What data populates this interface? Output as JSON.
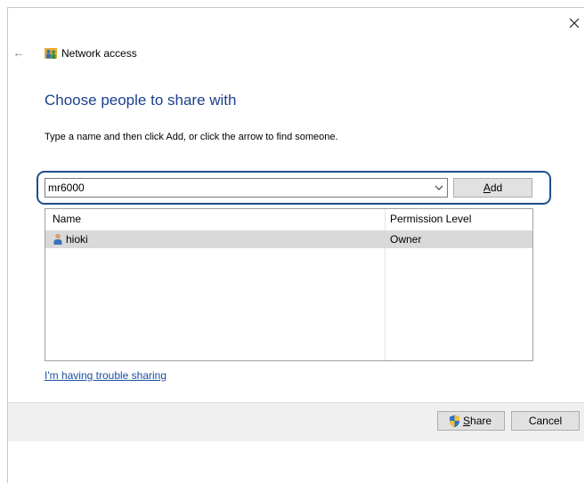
{
  "window": {
    "title": "Network access",
    "close_glyph": "×",
    "back_glyph": "←"
  },
  "main": {
    "heading": "Choose people to share with",
    "instruction": "Type a name and then click Add, or click the arrow to find someone."
  },
  "name_combo": {
    "value": "mr6000"
  },
  "add_button": {
    "accel": "A",
    "rest": "dd"
  },
  "table": {
    "columns": [
      "Name",
      "Permission Level"
    ],
    "rows": [
      {
        "name": "hioki",
        "permission": "Owner"
      }
    ]
  },
  "help_link": "I'm having trouble sharing",
  "footer": {
    "share_button": {
      "accel": "S",
      "rest": "hare"
    },
    "cancel_label": "Cancel"
  },
  "colors": {
    "heading": "#1b3f8f",
    "link": "#1a4fa0",
    "highlight_border": "#1f4e8c",
    "selected_row": "#d9d9d9",
    "footer_bg": "#f0f0f0"
  },
  "icons": {
    "title": "network-users-icon",
    "row": "user-icon",
    "share": "uac-shield-icon",
    "combo": "chevron-down-icon"
  }
}
